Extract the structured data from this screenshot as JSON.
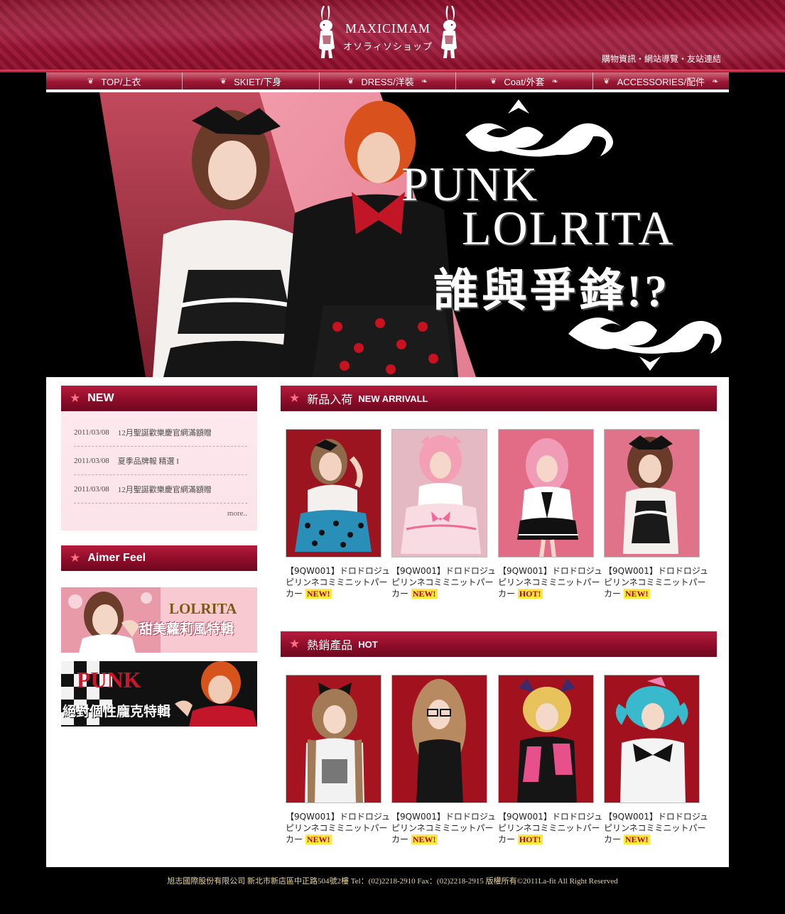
{
  "header": {
    "brand": "MAXICIMAM",
    "brand_sub": "オソラィソショップ",
    "links": "購物資訊・網站導覽・友站連結"
  },
  "nav": [
    {
      "label": "TOP/上衣"
    },
    {
      "label": "SKIET/下身"
    },
    {
      "label": "DRESS/洋裝"
    },
    {
      "label": "Coat/外套"
    },
    {
      "label": "ACCESSORIES/配件"
    }
  ],
  "banner": {
    "line1": "PUNK",
    "line2": "LOLRITA",
    "line3": "誰與爭鋒!?"
  },
  "news": {
    "title": "NEW",
    "items": [
      {
        "date": "2011/03/08",
        "text": "12月聖誕歡樂慶官網滿額贈"
      },
      {
        "date": "2011/03/08",
        "text": "夏季品牌報 精選 I"
      },
      {
        "date": "2011/03/08",
        "text": "12月聖誕歡樂慶官網滿額贈"
      }
    ],
    "more": "more.."
  },
  "aimer": {
    "title": "Aimer Feel",
    "promo1_title": "LOLRITA",
    "promo1_sub": "甜美蘿莉風特輯",
    "promo2_title": "PUNK",
    "promo2_sub": "絕對個性龐克特輯"
  },
  "new_arrival": {
    "title_cn": "新品入荷",
    "title_en": "NEW ARRIVALL",
    "products": [
      {
        "caption": "【9QW001】ドロドロジュピリンネコミミニットパーカー",
        "tag": "NEW!"
      },
      {
        "caption": "【9QW001】ドロドロジュピリンネコミミニットパーカー",
        "tag": "NEW!"
      },
      {
        "caption": "【9QW001】ドロドロジュピリンネコミミニットパーカー",
        "tag": "HOT!"
      },
      {
        "caption": "【9QW001】ドロドロジュピリンネコミミニットパーカー",
        "tag": "NEW!"
      }
    ]
  },
  "hot": {
    "title_cn": "熱銷產品",
    "title_en": "HOT",
    "products": [
      {
        "caption": "【9QW001】ドロドロジュピリンネコミミニットパーカー",
        "tag": "NEW!"
      },
      {
        "caption": "【9QW001】ドロドロジュピリンネコミミニットパーカー",
        "tag": "NEW!"
      },
      {
        "caption": "【9QW001】ドロドロジュピリンネコミミニットパーカー",
        "tag": "HOT!"
      },
      {
        "caption": "【9QW001】ドロドロジュピリンネコミミニットパーカー",
        "tag": "NEW!"
      }
    ]
  },
  "footer": {
    "text": "旭志國際股份有限公司 新北市新店區中正路504號2樓 Tel：(02)2218-2910 Fax：(02)2218-2915 版權所有©2011La-fit All Right Reserved"
  },
  "colors": {
    "brand_red": "#8e0d2a",
    "tag_yellow": "#ffea3a",
    "footer_gold": "#e8d39a"
  }
}
